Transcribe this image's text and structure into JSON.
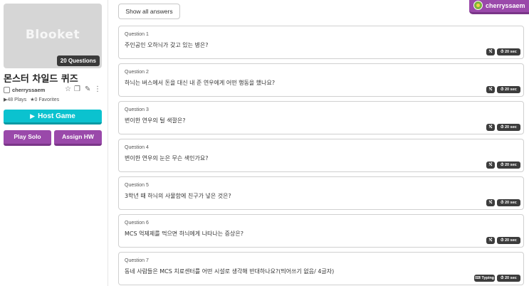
{
  "set": {
    "cover_logo": "Blooket",
    "question_count": "20 Questions",
    "title": "몬스터 차일드 퀴즈",
    "author": "cherryssaem",
    "plays": "48 Plays",
    "favorites": "0 Favorites"
  },
  "actions": {
    "host_game": "Host Game",
    "play_solo": "Play Solo",
    "assign_hw": "Assign HW"
  },
  "toolbar": {
    "show_all": "Show all answers"
  },
  "user": {
    "name": "cherryssaem"
  },
  "icons": {
    "star": "☆",
    "copy": "❐",
    "edit": "✎",
    "more": "⋮",
    "play": "▶",
    "shuffle": "⤭",
    "timer": "⏱",
    "keyboard": "⌨",
    "caret": "▾"
  },
  "questions": [
    {
      "label": "Question 1",
      "text": "주인공인 오하늬가 갖고 있는 병은?",
      "mode": "",
      "time": "20 sec"
    },
    {
      "label": "Question 2",
      "text": "하늬는 버스에서 돈을 대신 내 준 연우에게 어떤 행동을 했나요?",
      "mode": "",
      "time": "20 sec"
    },
    {
      "label": "Question 3",
      "text": "변이한 연우의 털 색깔은?",
      "mode": "",
      "time": "20 sec"
    },
    {
      "label": "Question 4",
      "text": "변이한 연우의 눈은 무슨 색인가요?",
      "mode": "",
      "time": "20 sec"
    },
    {
      "label": "Question 5",
      "text": "3학년 때 하늬의 사물함에 친구가 넣은 것은?",
      "mode": "",
      "time": "20 sec"
    },
    {
      "label": "Question 6",
      "text": "MCS 억제제를 먹으면 하늬에게 나타나는 증상은?",
      "mode": "",
      "time": "20 sec"
    },
    {
      "label": "Question 7",
      "text": "동네 사람들은 MCS 치료센터를 어떤 시설로 생각해 반대하나요?(띄어쓰기 없음/ 4글자)",
      "mode": "Typing",
      "time": "20 sec"
    }
  ],
  "colors": {
    "accent_teal": "#0bc2cf",
    "accent_purple": "#9a49aa"
  }
}
